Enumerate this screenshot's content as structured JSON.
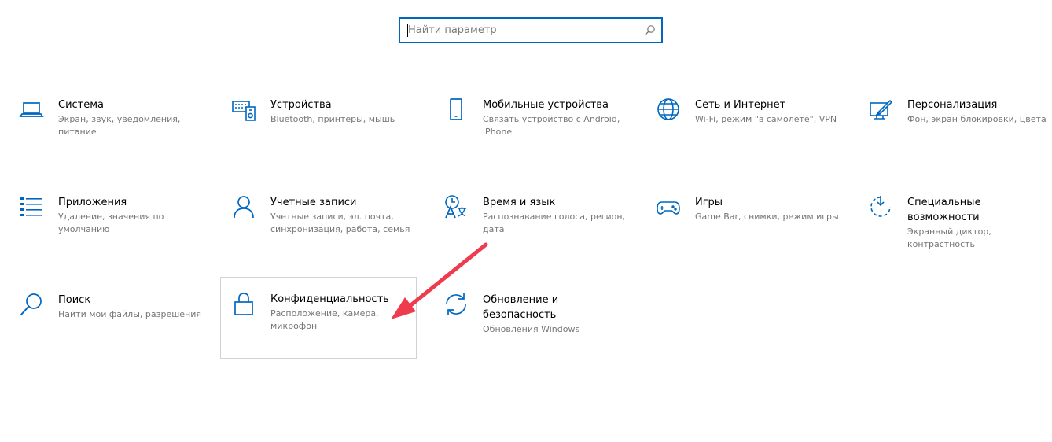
{
  "search": {
    "placeholder": "Найти параметр",
    "value": ""
  },
  "accent_color": "#0067c0",
  "annotation_color": "#ef3b4e",
  "tiles": [
    {
      "icon": "laptop-icon",
      "title": "Система",
      "desc": "Экран, звук, уведомления, питание"
    },
    {
      "icon": "devices-icon",
      "title": "Устройства",
      "desc": "Bluetooth, принтеры, мышь"
    },
    {
      "icon": "phone-icon",
      "title": "Мобильные устройства",
      "desc": "Связать устройство с Android, iPhone"
    },
    {
      "icon": "globe-icon",
      "title": "Сеть и Интернет",
      "desc": "Wi-Fi, режим \"в самолете\", VPN"
    },
    {
      "icon": "personalization-icon",
      "title": "Персонализация",
      "desc": "Фон, экран блокировки, цвета"
    },
    {
      "icon": "apps-list-icon",
      "title": "Приложения",
      "desc": "Удаление, значения по умолчанию"
    },
    {
      "icon": "person-icon",
      "title": "Учетные записи",
      "desc": "Учетные записи, эл. почта, синхронизация, работа, семья"
    },
    {
      "icon": "time-language-icon",
      "title": "Время и язык",
      "desc": "Распознавание голоса, регион, дата"
    },
    {
      "icon": "gamepad-icon",
      "title": "Игры",
      "desc": "Game Bar, снимки, режим игры"
    },
    {
      "icon": "accessibility-icon",
      "title": "Специальные возможности",
      "desc": "Экранный диктор, контрастность"
    },
    {
      "icon": "search-icon",
      "title": "Поиск",
      "desc": "Найти мои файлы, разрешения"
    },
    {
      "icon": "lock-icon",
      "title": "Конфиденциальность",
      "desc": "Расположение, камера, микрофон"
    },
    {
      "icon": "sync-icon",
      "title": "Обновление и безопасность",
      "desc": "Обновления Windows"
    }
  ]
}
